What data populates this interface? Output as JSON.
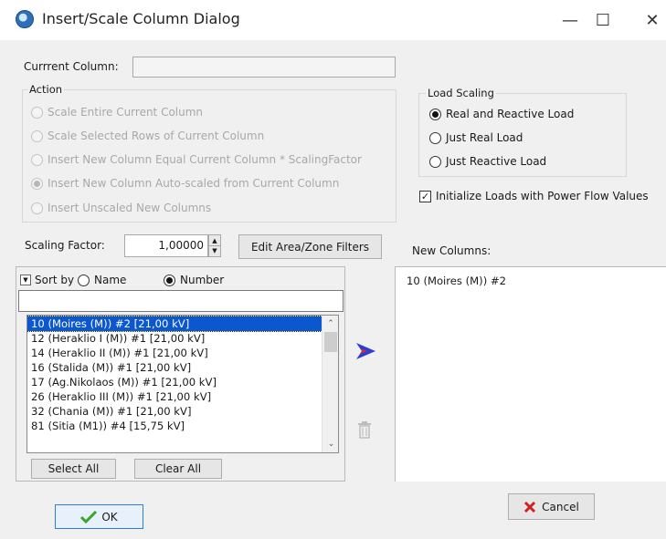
{
  "window": {
    "title": "Insert/Scale Column Dialog",
    "minimize_glyph": "—",
    "maximize_glyph": "☐",
    "close_glyph": "✕"
  },
  "current_column": {
    "label": "Currrent Column:",
    "value": ""
  },
  "action": {
    "legend": "Action",
    "options": [
      {
        "label": "Scale Entire Current Column",
        "checked": false
      },
      {
        "label": "Scale Selected Rows of Current Column",
        "checked": false
      },
      {
        "label": "Insert New Column Equal Current Column * ScalingFactor",
        "checked": false
      },
      {
        "label": "Insert New Column Auto-scaled from Current Column",
        "checked": true
      },
      {
        "label": "Insert Unscaled New Columns",
        "checked": false
      }
    ]
  },
  "load_scaling": {
    "legend": "Load Scaling",
    "options": [
      {
        "label": "Real and Reactive Load",
        "checked": true
      },
      {
        "label": "Just Real Load",
        "checked": false
      },
      {
        "label": "Just Reactive Load",
        "checked": false
      }
    ],
    "init_checkbox": {
      "label": "Initialize Loads with Power Flow Values",
      "checked": true
    }
  },
  "scaling_factor": {
    "label": "Scaling Factor:",
    "value": "1,00000"
  },
  "edit_filters_button": "Edit Area/Zone Filters",
  "new_columns": {
    "label": "New Columns:",
    "items": [
      "10 (Moires (M)) #2"
    ]
  },
  "sort": {
    "label": "Sort by",
    "name_label": "Name",
    "number_label": "Number",
    "selected": "Number"
  },
  "filter_input": {
    "value": ""
  },
  "source_list": {
    "items": [
      "10 (Moires (M)) #2  [21,00 kV]",
      "12 (Heraklio I (M)) #1  [21,00 kV]",
      "14 (Heraklio II (M)) #1  [21,00 kV]",
      "16 (Stalida (M)) #1  [21,00 kV]",
      "17 (Ag.Nikolaos (M)) #1  [21,00 kV]",
      "26 (Heraklio III (M)) #1  [21,00 kV]",
      "32 (Chania (M)) #1  [21,00 kV]",
      "81 (Sitia (M1)) #4  [15,75 kV]"
    ],
    "selected_index": 0
  },
  "select_all_button": "Select All",
  "clear_all_button": "Clear All",
  "ok_button": "OK",
  "cancel_button": "Cancel",
  "colors": {
    "selection": "#0a57d0",
    "arrow_blue": "#2b3fd6",
    "arrow_red": "#d42a2a",
    "ok_check": "#3aa52b",
    "cancel_x": "#d42020"
  }
}
